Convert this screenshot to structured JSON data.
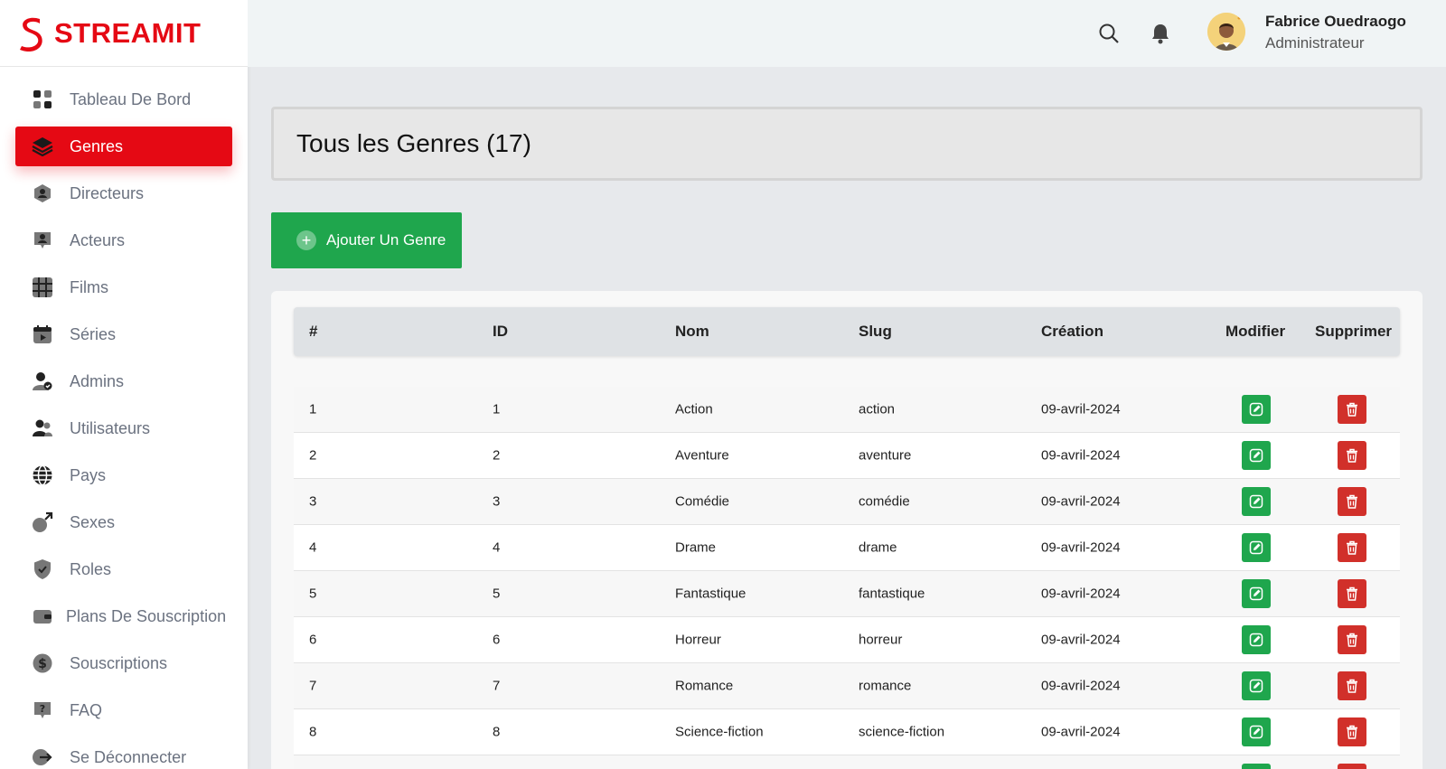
{
  "brand": {
    "name": "STREAMIT",
    "color": "#e50914"
  },
  "sidebar": {
    "items": [
      {
        "label": "Tableau De Bord",
        "icon": "dashboard-icon",
        "active": false
      },
      {
        "label": "Genres",
        "icon": "layers-icon",
        "active": true
      },
      {
        "label": "Directeurs",
        "icon": "director-icon",
        "active": false
      },
      {
        "label": "Acteurs",
        "icon": "actor-icon",
        "active": false
      },
      {
        "label": "Films",
        "icon": "film-icon",
        "active": false
      },
      {
        "label": "Séries",
        "icon": "series-icon",
        "active": false
      },
      {
        "label": "Admins",
        "icon": "admin-icon",
        "active": false
      },
      {
        "label": "Utilisateurs",
        "icon": "users-icon",
        "active": false
      },
      {
        "label": "Pays",
        "icon": "globe-icon",
        "active": false
      },
      {
        "label": "Sexes",
        "icon": "gender-icon",
        "active": false
      },
      {
        "label": "Roles",
        "icon": "shield-check-icon",
        "active": false
      },
      {
        "label": "Plans De Souscription",
        "icon": "wallet-icon",
        "active": false
      },
      {
        "label": "Souscriptions",
        "icon": "dollar-icon",
        "active": false
      },
      {
        "label": "FAQ",
        "icon": "question-icon",
        "active": false
      },
      {
        "label": "Se Déconnecter",
        "icon": "logout-icon",
        "active": false
      }
    ]
  },
  "header": {
    "user_name": "Fabrice Ouedraogo",
    "user_role": "Administrateur"
  },
  "main": {
    "title": "Tous les Genres (17)",
    "add_button": "Ajouter Un Genre"
  },
  "table": {
    "headers": [
      "#",
      "ID",
      "Nom",
      "Slug",
      "Création",
      "Modifier",
      "Supprimer"
    ],
    "rows": [
      {
        "num": "1",
        "id": "1",
        "name": "Action",
        "slug": "action",
        "date": "09-avril-2024"
      },
      {
        "num": "2",
        "id": "2",
        "name": "Aventure",
        "slug": "aventure",
        "date": "09-avril-2024"
      },
      {
        "num": "3",
        "id": "3",
        "name": "Comédie",
        "slug": "comédie",
        "date": "09-avril-2024"
      },
      {
        "num": "4",
        "id": "4",
        "name": "Drame",
        "slug": "drame",
        "date": "09-avril-2024"
      },
      {
        "num": "5",
        "id": "5",
        "name": "Fantastique",
        "slug": "fantastique",
        "date": "09-avril-2024"
      },
      {
        "num": "6",
        "id": "6",
        "name": "Horreur",
        "slug": "horreur",
        "date": "09-avril-2024"
      },
      {
        "num": "7",
        "id": "7",
        "name": "Romance",
        "slug": "romance",
        "date": "09-avril-2024"
      },
      {
        "num": "8",
        "id": "8",
        "name": "Science-fiction",
        "slug": "science-fiction",
        "date": "09-avril-2024"
      }
    ]
  },
  "colors": {
    "accent_red": "#e50914",
    "edit_green": "#1fa64d",
    "delete_red": "#d1302a"
  }
}
